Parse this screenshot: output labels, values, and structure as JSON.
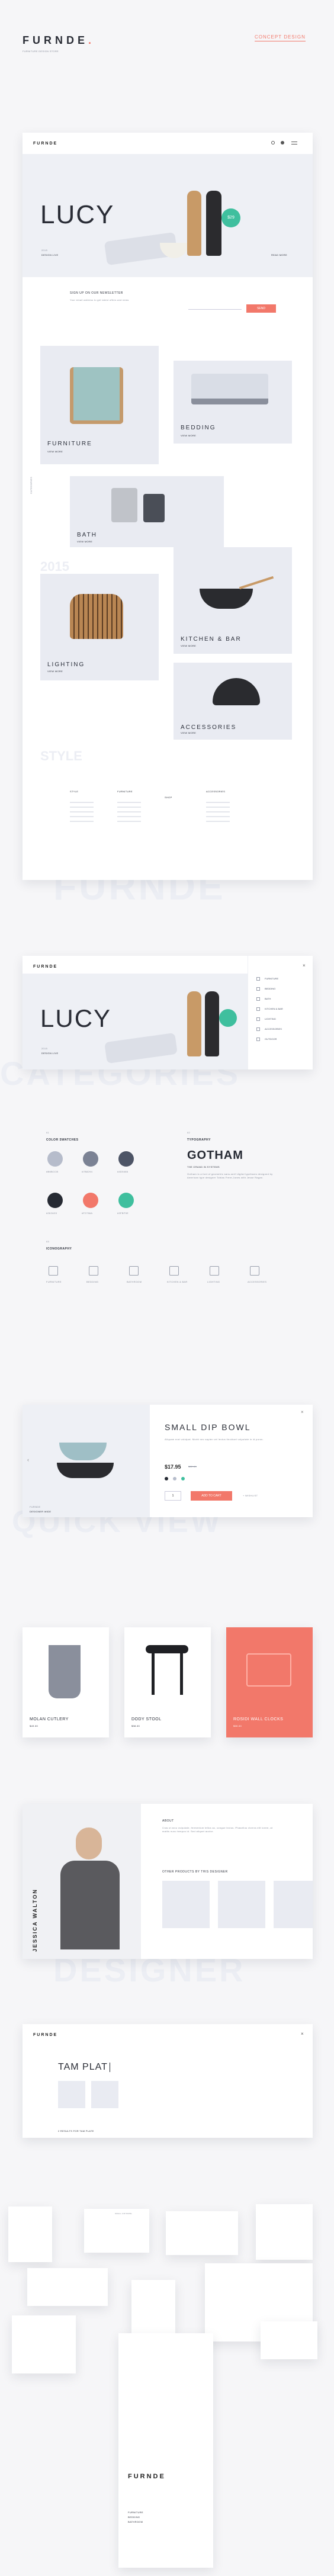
{
  "brand": {
    "name": "FURNDE",
    "dot": ".",
    "tagline": "FURNITURE DESIGN STORE",
    "badge": "CONCEPT DESIGN"
  },
  "ghost": {
    "s1": "FURNDE",
    "s2": "CATEGORIES",
    "s3": "QUICK VIEW",
    "s4": "DESIGNER"
  },
  "home": {
    "logo": "FURNDE",
    "hero_title": "LUCY",
    "hero_kicker": "2015",
    "hero_sub": "DESIGN LIVE",
    "price_badge": "$29",
    "hero_link": "READ MORE",
    "newsletter_title": "SIGN UP ON OUR NEWSLETTER",
    "newsletter_text": "Your email address to get latest offers and news",
    "newsletter_button": "SEND",
    "cats": [
      {
        "name": "FURNITURE",
        "sub": "VIEW MORE"
      },
      {
        "name": "BEDDING",
        "sub": "VIEW MORE"
      },
      {
        "name": "BATH",
        "sub": "VIEW MORE"
      },
      {
        "name": "LIGHTING",
        "sub": "VIEW MORE"
      },
      {
        "name": "KITCHEN & BAR",
        "sub": "VIEW MORE"
      },
      {
        "name": "ACCESSORIES",
        "sub": "VIEW MORE"
      }
    ],
    "side_label": "CATEGORIES",
    "year": "2015",
    "style": "STYLE",
    "footer_cols": [
      "STYLE",
      "FURNITURE",
      "SHOP",
      "ACCESSORIES"
    ]
  },
  "menu": {
    "logo": "FURNDE",
    "hero_title": "LUCY",
    "hero_kicker": "2015",
    "hero_sub": "DESIGN LIVE",
    "items": [
      "FURNITURE",
      "BEDDING",
      "BATH",
      "KITCHEN & BAR",
      "LIGHTING",
      "ACCESSORIES",
      "OUTDOOR"
    ]
  },
  "style_guide": {
    "colors_num": "01",
    "colors_title": "COLOR SWATCHES",
    "type_num": "02",
    "type_title": "TYPOGRAPHY",
    "type_font": "GOTHAM",
    "type_sub": "THE GRAND IN SYSTEMS",
    "type_body": "Gotham is a font of geometric sans-serif digital typefaces designed by American type designer Tobias Frere-Jones with Jesse Ragan.",
    "icons_num": "03",
    "icons_title": "ICONOGRAPHY",
    "swatches": [
      {
        "color": "#b6bccb",
        "label": "#B6BCCB"
      },
      {
        "color": "#7b8294",
        "label": "#7B8294"
      },
      {
        "color": "#4d5466",
        "label": "#4D5466"
      },
      {
        "color": "#262a33",
        "label": "#262A33"
      },
      {
        "color": "#f2786a",
        "label": "#F2786A"
      },
      {
        "color": "#3fbf9e",
        "label": "#3FBF9E"
      }
    ],
    "icons": [
      "FURNITURE",
      "BEDDING",
      "BATHROOM",
      "KITCHEN & BAR",
      "LIGHTING",
      "ACCESSORIES"
    ]
  },
  "quick_view": {
    "title": "SMALL DIP BOWL",
    "desc": "Aliquam erat volutpat. Morbi nec sapien vel lectus tincidunt vulputate in id purus.",
    "price": "$17.95",
    "old_price": "$22.50",
    "qty": "1",
    "cart_button": "ADD TO CART",
    "wishlist": "+ WISHLIST",
    "caption_kicker": "FURNDE",
    "caption": "DESIGNER WIDE"
  },
  "products": [
    {
      "name": "MOLAN CUTLERY",
      "price": "$49.00"
    },
    {
      "name": "DODY STOOL",
      "price": "$98.00"
    },
    {
      "name": "ROSIDI WALL CLOCKS",
      "price": "$55.00"
    }
  ],
  "designer": {
    "name": "JESSICA WALTON",
    "about_title": "ABOUT",
    "about_text": "Cras ut arcu vulputate, fermentum tellus ac, congue lectus. Phasellus viverra elit lorem, at mattis nunc tempus id. Sed aliquet auctor.",
    "other_title": "OTHER PRODUCTS BY THIS DESIGNER"
  },
  "search": {
    "logo": "FURNDE",
    "query": "TAM PLAT",
    "results_label": "2 RESULTS FOR TAM PLATE"
  },
  "mockups": {
    "logo": "FURNDE",
    "menu": [
      "FURNITURE",
      "BEDDING",
      "BATHROOM"
    ],
    "title": "SMALL DIP BOWL"
  }
}
